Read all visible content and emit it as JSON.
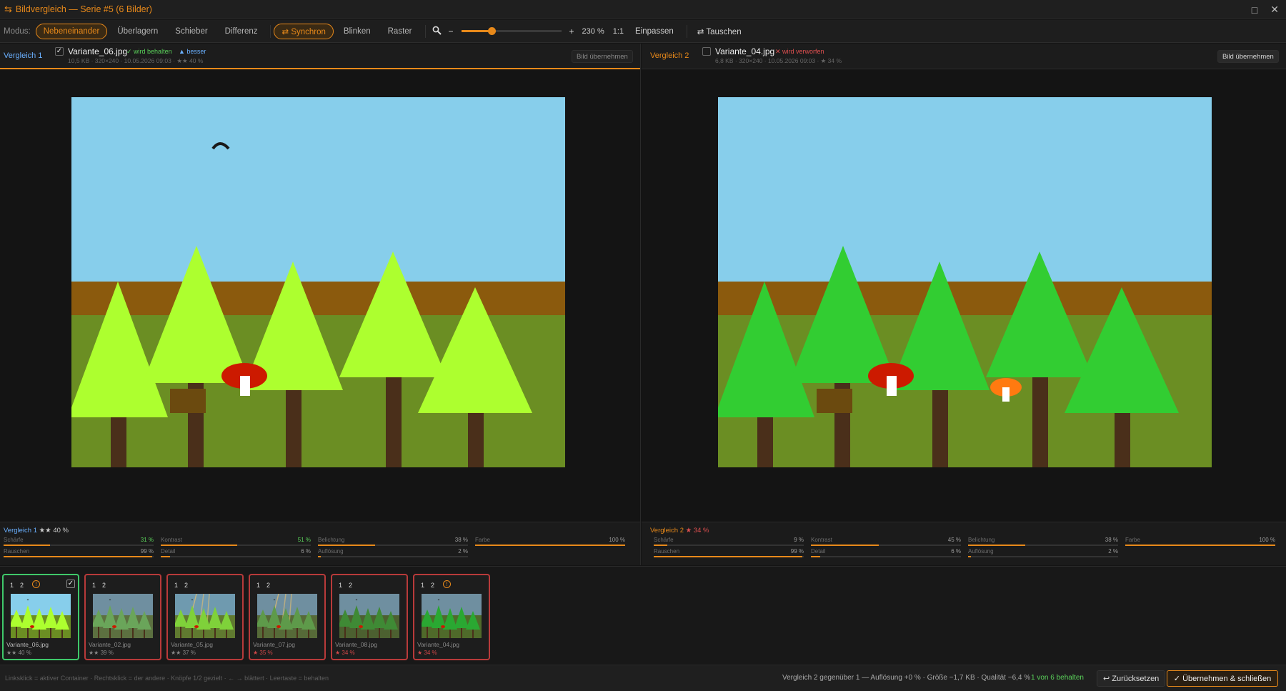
{
  "window": {
    "title": "Bildvergleich — Serie #5 (6 Bilder)",
    "title_icon": "compare-icon",
    "maximize_icon": "□",
    "close_icon": "✕"
  },
  "toolbar": {
    "mode_label": "Modus:",
    "modes": [
      "Nebeneinander",
      "Überlagern",
      "Schieber",
      "Differenz"
    ],
    "active_mode": "Nebeneinander",
    "sync_label": "⇄ Synchron",
    "blink_label": "Blinken",
    "grid_label": "Raster",
    "zoom_minus": "−",
    "zoom_plus": "+",
    "zoom_value": "230 %",
    "zoom_fraction": 0.3,
    "one_to_one": "1:1",
    "fit": "Einpassen",
    "swap": "⇄ Tauschen"
  },
  "left": {
    "label": "Vergleich 1",
    "checked": "✓",
    "filename": "Variante_06.jpg",
    "badge_kept": "✓ wird behalten",
    "badge_better": "▲ besser",
    "meta": "10,5 KB · 320×240 · 10.05.2026 09:03 · ★★ 40 %",
    "take_button": "Bild übernehmen",
    "metrics_title": "Vergleich 1",
    "metrics_score": "★★ 40 %",
    "metrics": [
      {
        "name": "Schärfe",
        "value": "31 %",
        "pct": 31,
        "highlight": true
      },
      {
        "name": "Kontrast",
        "value": "51 %",
        "pct": 51,
        "highlight": true
      },
      {
        "name": "Belichtung",
        "value": "38 %",
        "pct": 38
      },
      {
        "name": "Farbe",
        "value": "100 %",
        "pct": 100
      },
      {
        "name": "Rauschen",
        "value": "99 %",
        "pct": 99
      },
      {
        "name": "Detail",
        "value": "6 %",
        "pct": 6
      },
      {
        "name": "Auflösung",
        "value": "2 %",
        "pct": 2
      }
    ]
  },
  "right": {
    "label": "Vergleich 2",
    "filename": "Variante_04.jpg",
    "badge_rejected": "✕ wird verworfen",
    "meta": "6,8 KB · 320×240 · 10.05.2026 09:03 · ★ 34 %",
    "take_button": "Bild übernehmen",
    "metrics_title": "Vergleich 2",
    "metrics_score": "★ 34 %",
    "metrics": [
      {
        "name": "Schärfe",
        "value": "9 %",
        "pct": 9
      },
      {
        "name": "Kontrast",
        "value": "45 %",
        "pct": 45
      },
      {
        "name": "Belichtung",
        "value": "38 %",
        "pct": 38
      },
      {
        "name": "Farbe",
        "value": "100 %",
        "pct": 100
      },
      {
        "name": "Rauschen",
        "value": "99 %",
        "pct": 99
      },
      {
        "name": "Detail",
        "value": "6 %",
        "pct": 6
      },
      {
        "name": "Auflösung",
        "value": "2 %",
        "pct": 2
      }
    ]
  },
  "thumbnails": [
    {
      "name": "Variante_06.jpg",
      "score": "★★ 40 %",
      "warn": true,
      "checked": true,
      "sel": true,
      "theme": "bright"
    },
    {
      "name": "Variante_02.jpg",
      "score": "★★ 39 %",
      "theme": "gray"
    },
    {
      "name": "Variante_05.jpg",
      "score": "★★ 37 %",
      "theme": "bright2"
    },
    {
      "name": "Variante_07.jpg",
      "score": "★ 35 %",
      "theme": "rays",
      "red": true
    },
    {
      "name": "Variante_08.jpg",
      "score": "★ 34 %",
      "theme": "dark",
      "red": true
    },
    {
      "name": "Variante_04.jpg",
      "score": "★ 34 %",
      "warn": true,
      "theme": "green",
      "red": true
    }
  ],
  "thumb_labels": {
    "one": "1",
    "two": "2",
    "warn": "!",
    "check": "✓"
  },
  "status": {
    "hint": "Linksklick = aktiver Container · Rechtsklick = der andere · Knöpfe 1/2 gezielt · ← → blättert · Leertaste = behalten",
    "info": "Vergleich 2 gegenüber 1 — Auflösung +0 % · Größe −1,7 KB · Qualität −6,4 %",
    "kept": "1 von 6 behalten",
    "reset": "↩ Zurücksetzen",
    "accept": "✓ Übernehmen & schließen"
  },
  "colors": {
    "accent": "#e8891a",
    "left_label": "#6ab0ff",
    "good": "#5ad15a",
    "bad": "#e05050"
  }
}
